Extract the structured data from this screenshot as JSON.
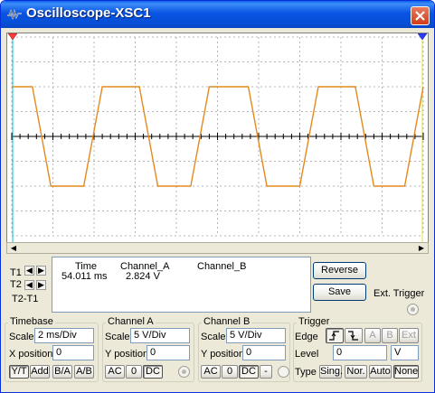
{
  "window": {
    "title": "Oscilloscope-XSC1"
  },
  "colors": {
    "trace": "#e38a1e",
    "grid": "#b4b4b4",
    "cursor1": "#ff3b3b",
    "cursor2": "#2b3cff"
  },
  "trace_data": {
    "channel": "Channel_A",
    "timebase_ms_per_div": 2,
    "volts_per_div": 5,
    "x_range_ms": [
      0,
      20
    ],
    "levels_v": {
      "high": 10,
      "low": -10
    },
    "segments_ms": [
      [
        0.0,
        10
      ],
      [
        1.0,
        10
      ],
      [
        1.9,
        -10
      ],
      [
        3.5,
        -10
      ],
      [
        4.4,
        10
      ],
      [
        6.2,
        10
      ],
      [
        7.1,
        -10
      ],
      [
        8.7,
        -10
      ],
      [
        9.6,
        10
      ],
      [
        11.5,
        10
      ],
      [
        12.4,
        -10
      ],
      [
        14.0,
        -10
      ],
      [
        14.9,
        10
      ],
      [
        16.7,
        10
      ],
      [
        17.6,
        -10
      ],
      [
        19.1,
        -10
      ],
      [
        20.0,
        10
      ]
    ]
  },
  "readout": {
    "col_time": "Time",
    "col_chA": "Channel_A",
    "col_chB": "Channel_B",
    "time": "54.011 ms",
    "chA": "2.824 V",
    "chB": ""
  },
  "cursors": {
    "t1": "T1",
    "t2": "T2",
    "t2t1": "T2-T1"
  },
  "buttons": {
    "reverse": "Reverse",
    "save": "Save",
    "ext_trigger": "Ext. Trigger"
  },
  "timebase": {
    "title": "Timebase",
    "scale_label": "Scale",
    "scale": "2 ms/Div",
    "xpos_label": "X position",
    "xpos": "0",
    "modes": [
      "Y/T",
      "Add",
      "B/A",
      "A/B"
    ]
  },
  "channel_a": {
    "title": "Channel A",
    "scale_label": "Scale",
    "scale": "5  V/Div",
    "ypos_label": "Y position",
    "ypos": "0",
    "coupling": [
      "AC",
      "0",
      "DC"
    ]
  },
  "channel_b": {
    "title": "Channel B",
    "scale_label": "Scale",
    "scale": "5  V/Div",
    "ypos_label": "Y position",
    "ypos": "0",
    "coupling": [
      "AC",
      "0",
      "DC",
      "-"
    ]
  },
  "trigger": {
    "title": "Trigger",
    "edge_label": "Edge",
    "sources": [
      "A",
      "B",
      "Ext"
    ],
    "level_label": "Level",
    "level": "0",
    "level_unit": "V",
    "type_label": "Type",
    "types": [
      "Sing.",
      "Nor.",
      "Auto",
      "None"
    ]
  }
}
